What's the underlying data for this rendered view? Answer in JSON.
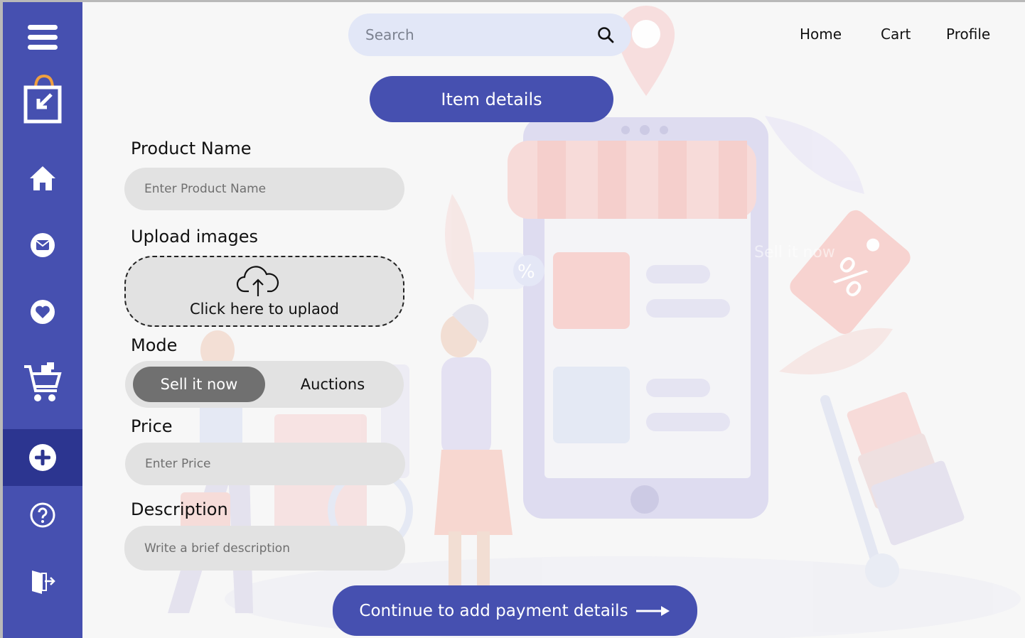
{
  "sidebar": {
    "items": [
      {
        "name": "menu",
        "icon": "hamburger-menu-icon"
      },
      {
        "name": "logo",
        "icon": "shopping-bag-logo-icon"
      },
      {
        "name": "home",
        "icon": "home-icon"
      },
      {
        "name": "messages",
        "icon": "mail-icon"
      },
      {
        "name": "favorites",
        "icon": "heart-icon"
      },
      {
        "name": "cart",
        "icon": "cart-icon"
      },
      {
        "name": "add-item",
        "icon": "plus-circle-icon",
        "active": true
      },
      {
        "name": "help",
        "icon": "question-icon"
      },
      {
        "name": "logout",
        "icon": "exit-door-icon"
      }
    ]
  },
  "search": {
    "placeholder": "Search",
    "icon": "search-icon"
  },
  "nav": {
    "home": "Home",
    "cart": "Cart",
    "profile": "Profile"
  },
  "header": {
    "title": "Item details"
  },
  "form": {
    "product_name": {
      "label": "Product Name",
      "placeholder": "Enter Product Name"
    },
    "upload": {
      "label": "Upload images",
      "text": "Click here to uplaod",
      "icon": "cloud-upload-icon"
    },
    "mode": {
      "label": "Mode",
      "options": [
        "Sell it now",
        "Auctions"
      ],
      "selected": "Sell it now"
    },
    "price": {
      "label": "Price",
      "placeholder": "Enter Price"
    },
    "description": {
      "label": "Description",
      "placeholder": "Write a brief description"
    }
  },
  "illustration": {
    "overlay_text": "Sell it now"
  },
  "continue": {
    "label": "Continue to add payment details",
    "icon": "arrow-right-icon"
  },
  "colors": {
    "accent": "#4650b0",
    "accent_dark": "#2c3590",
    "field_bg": "#e2e2e2",
    "search_bg": "#e2e7f7",
    "toggle_selected": "#707070"
  }
}
